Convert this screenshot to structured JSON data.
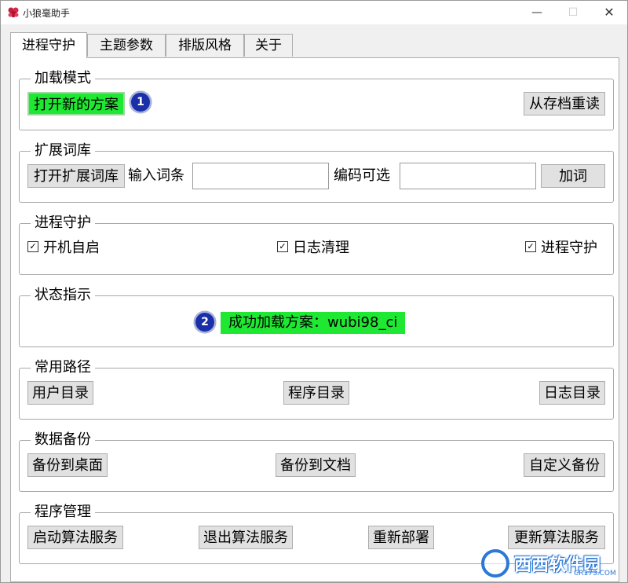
{
  "window": {
    "title": "小狼毫助手",
    "minimize_symbol": "—",
    "maximize_symbol": "☐",
    "close_symbol": "✕"
  },
  "tabs": [
    {
      "label": "进程守护"
    },
    {
      "label": "主题参数"
    },
    {
      "label": "排版风格"
    },
    {
      "label": "关于"
    }
  ],
  "groups": {
    "load_mode": {
      "title": "加载模式",
      "open_new_scheme": "打开新的方案",
      "reload_from_archive": "从存档重读",
      "badge": "1"
    },
    "ext_dict": {
      "title": "扩展词库",
      "open_ext_dict": "打开扩展词库",
      "input_entry_label": "输入词条",
      "input_entry_value": "",
      "code_optional_label": "编码可选",
      "code_value": "",
      "add_word": "加词"
    },
    "daemon": {
      "title": "进程守护",
      "autostart": "开机自启",
      "log_cleanup": "日志清理",
      "process_guard": "进程守护",
      "check_mark": "✓"
    },
    "status": {
      "title": "状态指示",
      "badge": "2",
      "message": "成功加载方案：wubi98_ci"
    },
    "paths": {
      "title": "常用路径",
      "user_dir": "用户目录",
      "program_dir": "程序目录",
      "log_dir": "日志目录"
    },
    "backup": {
      "title": "数据备份",
      "to_desktop": "备份到桌面",
      "to_documents": "备份到文档",
      "custom": "自定义备份"
    },
    "program": {
      "title": "程序管理",
      "start_service": "启动算法服务",
      "exit_service": "退出算法服务",
      "redeploy": "重新部署",
      "update_service": "更新算法服务"
    }
  },
  "watermark": {
    "text": "西西软件园",
    "sub": "CR173.COM"
  },
  "colors": {
    "highlight_green": "#1ee832",
    "badge_blue": "#1a2fa8"
  }
}
